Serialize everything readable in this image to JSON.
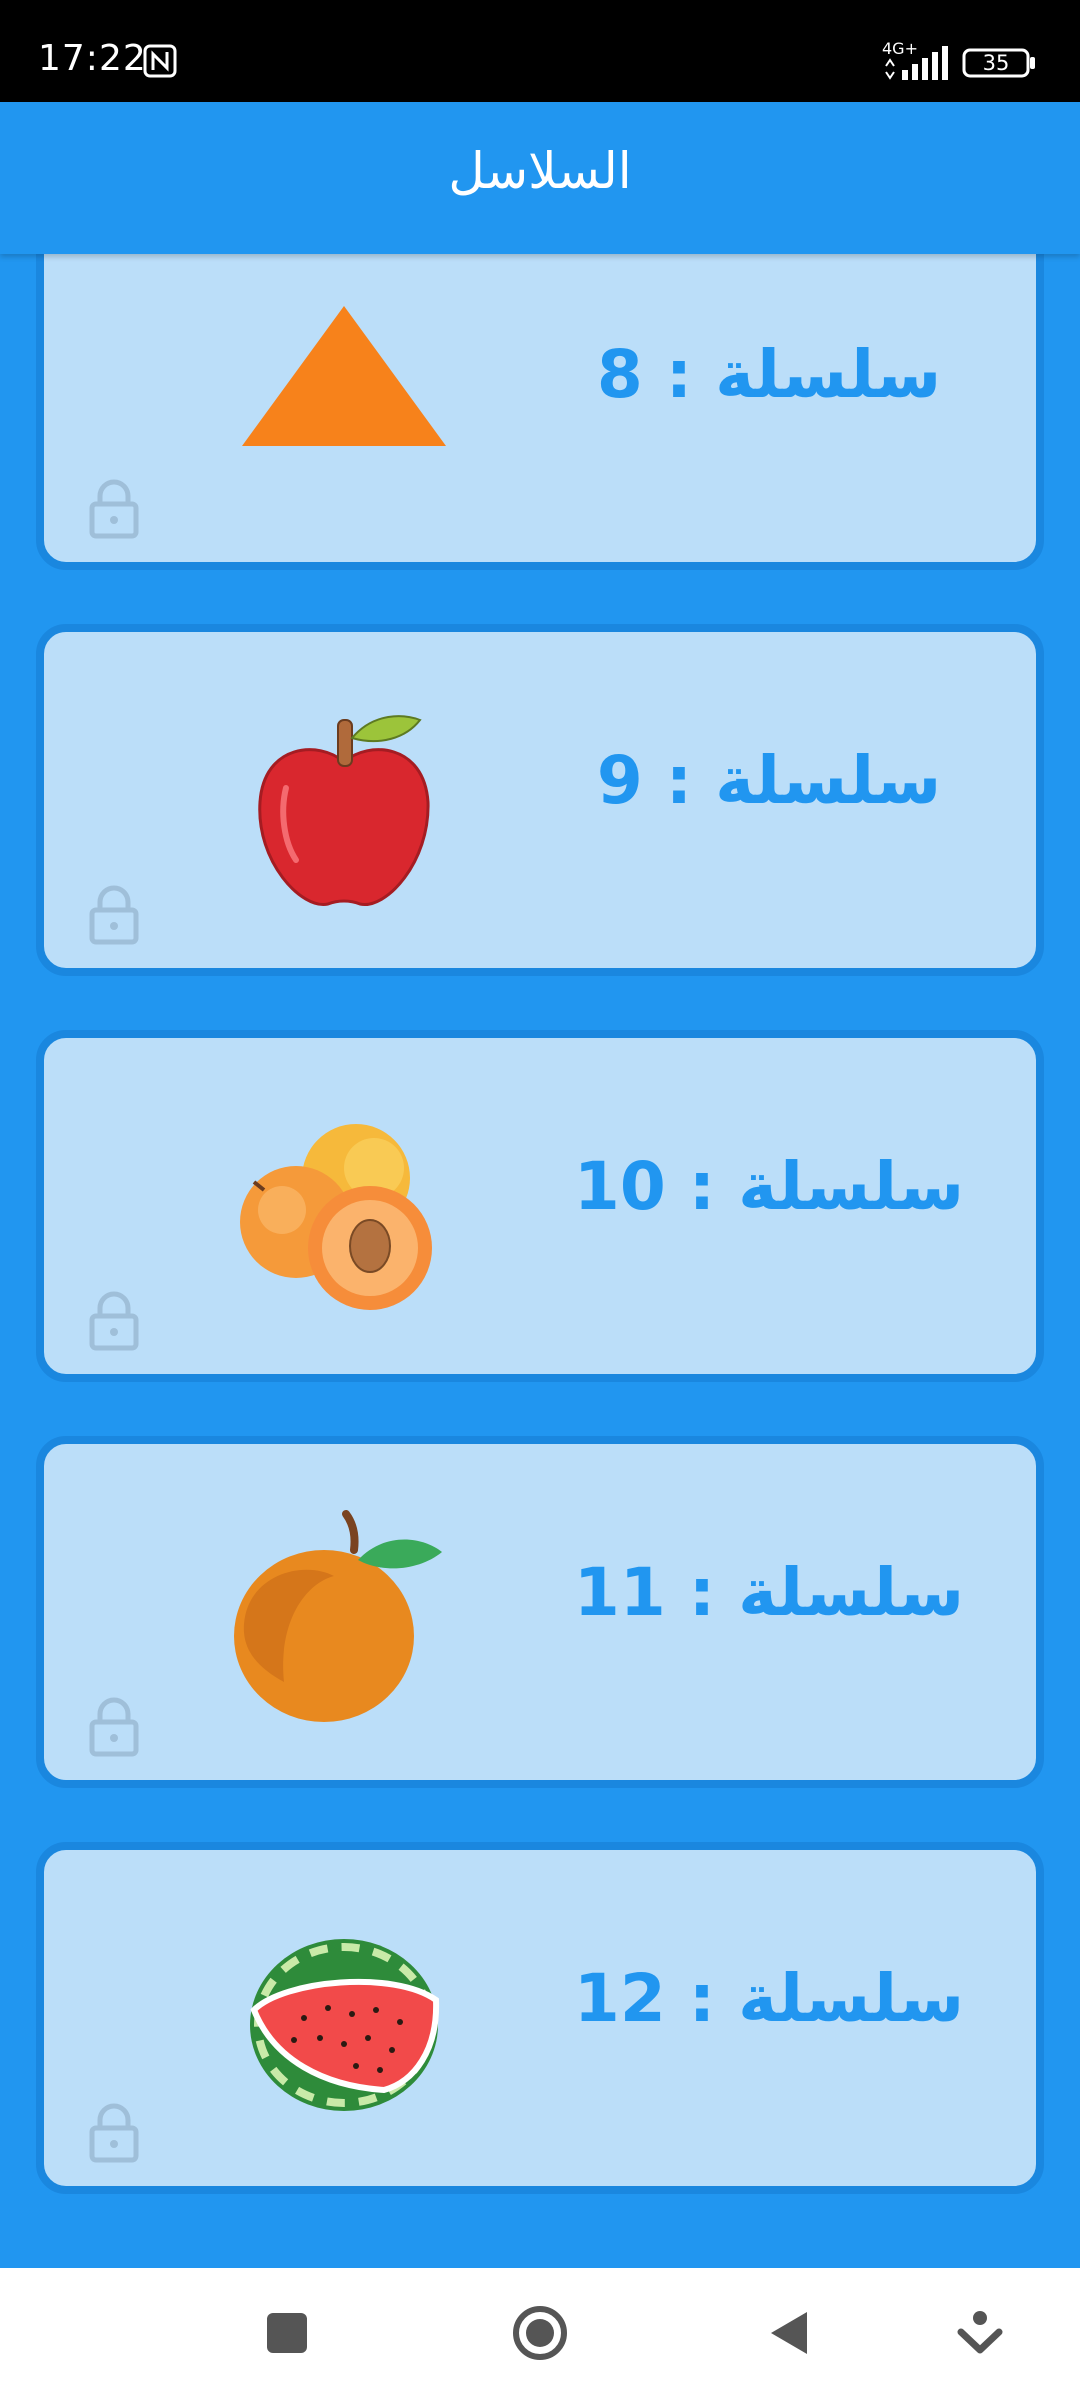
{
  "status_bar": {
    "time": "17:22",
    "network": "4G+",
    "battery": "35",
    "icons": [
      "nfc-icon",
      "signal-icon",
      "battery-icon"
    ]
  },
  "app_bar": {
    "title": "السلاسل"
  },
  "series": [
    {
      "label": "سلسلة : 8",
      "image": "triangle",
      "locked": true
    },
    {
      "label": "سلسلة : 9",
      "image": "apple",
      "locked": true
    },
    {
      "label": "سلسلة : 10",
      "image": "apricots",
      "locked": true
    },
    {
      "label": "سلسلة : 11",
      "image": "orange",
      "locked": true
    },
    {
      "label": "سلسلة : 12",
      "image": "watermelon",
      "locked": true
    }
  ],
  "nav_bar": {
    "icons": [
      "recents-square-icon",
      "home-circle-icon",
      "back-triangle-icon",
      "assistant-icon"
    ]
  },
  "colors": {
    "primary": "#2196f0",
    "card_bg": "#bbdef9",
    "card_border": "#1a87df",
    "text_accent": "#2196f0",
    "lock": "#9fbfd9"
  }
}
